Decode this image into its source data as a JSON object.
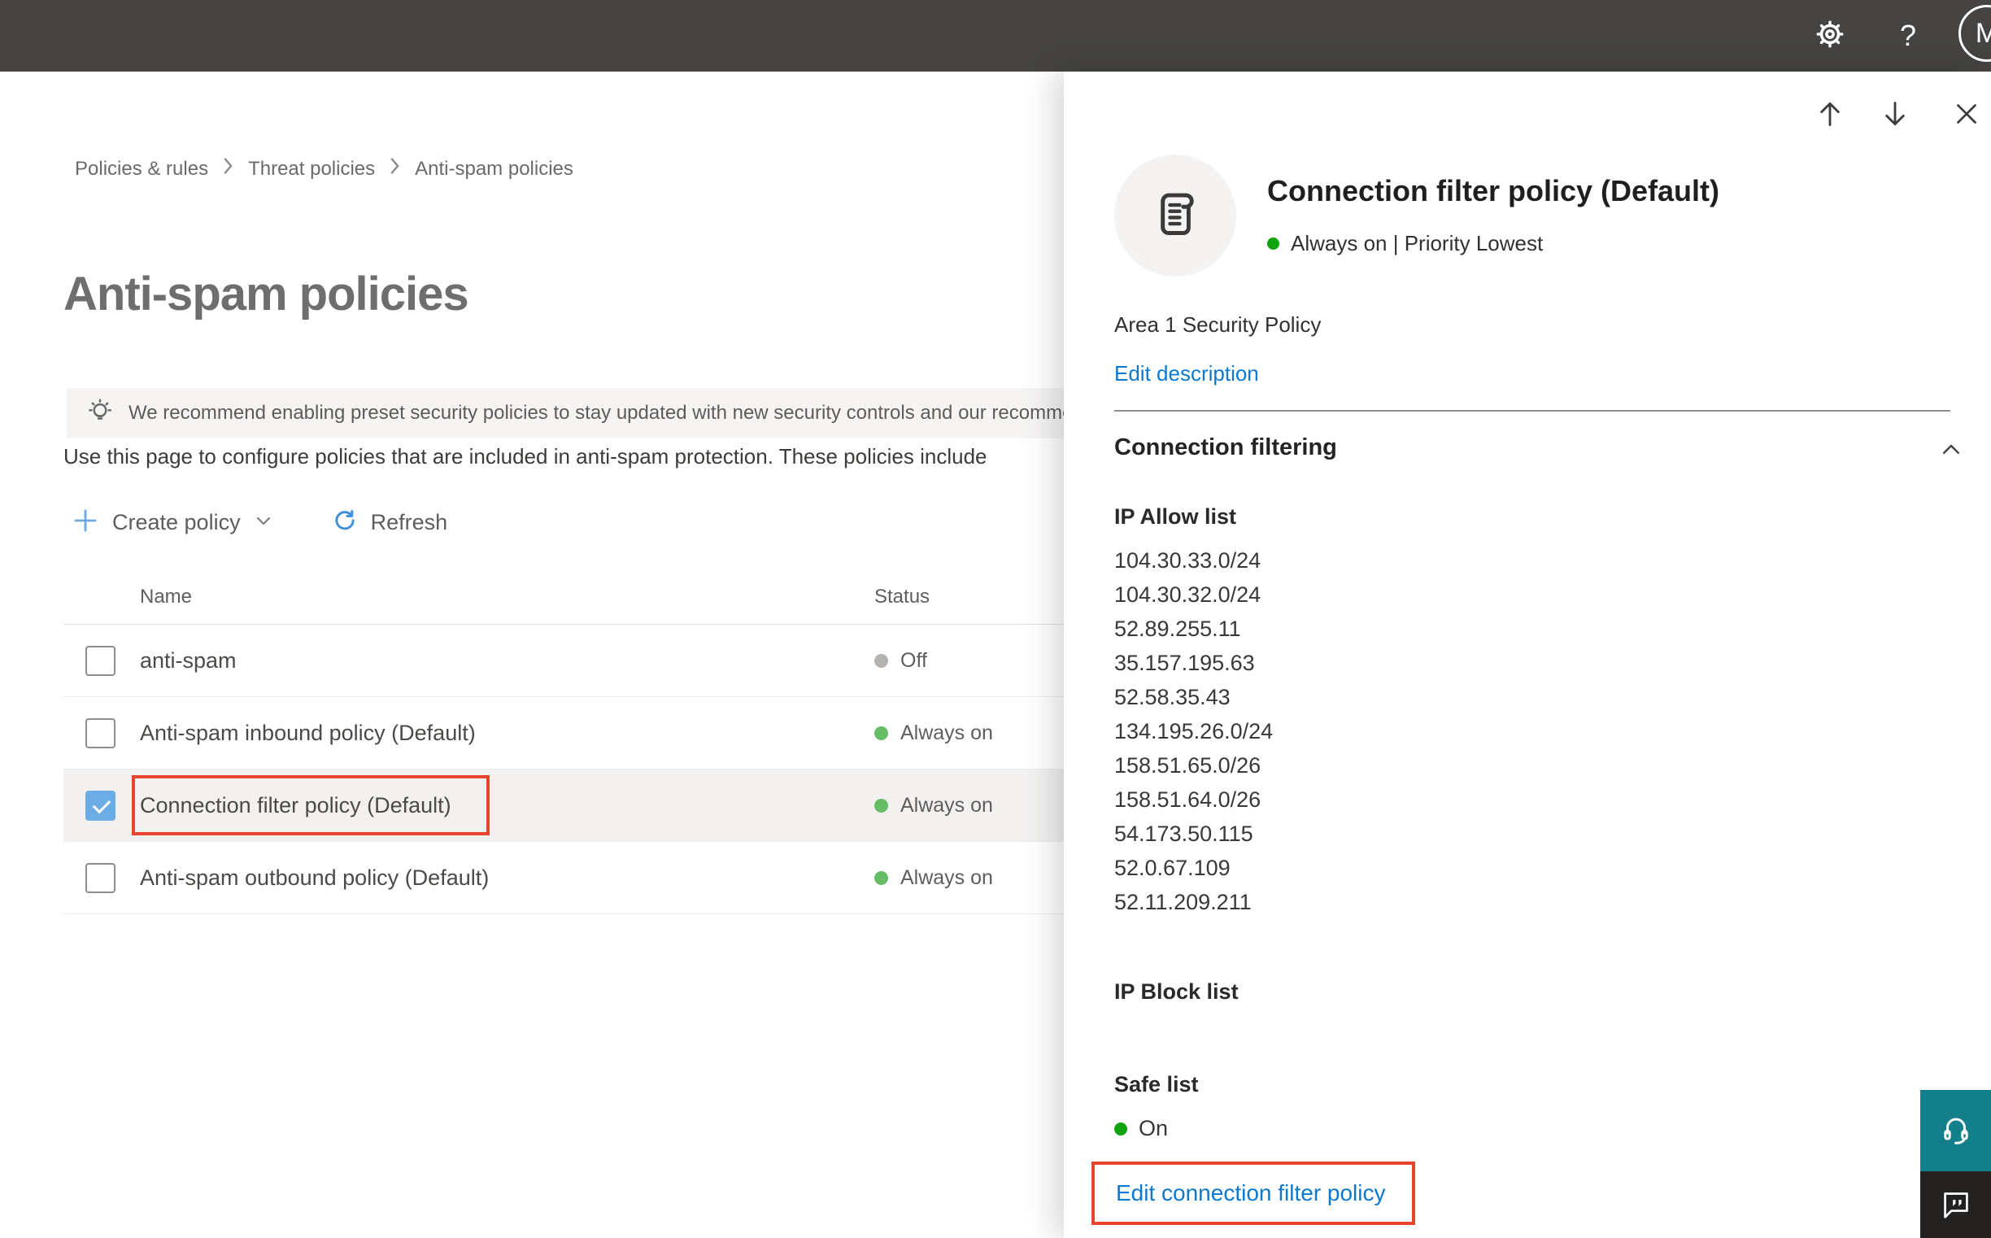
{
  "topbar": {
    "help_label": "?",
    "avatar_initial": "M"
  },
  "breadcrumb": {
    "items": [
      "Policies & rules",
      "Threat policies",
      "Anti-spam policies"
    ]
  },
  "page": {
    "title": "Anti-spam policies",
    "banner_text": "We recommend enabling preset security policies to stay updated with new security controls and our recomme",
    "intro_text": "Use this page to configure policies that are included in anti-spam protection. These policies include",
    "create_policy_label": "Create policy",
    "refresh_label": "Refresh"
  },
  "table": {
    "columns": [
      "Name",
      "Status"
    ],
    "rows": [
      {
        "name": "anti-spam",
        "status": "Off",
        "checked": false,
        "selected": false,
        "highlighted": false
      },
      {
        "name": "Anti-spam inbound policy (Default)",
        "status": "Always on",
        "checked": false,
        "selected": false,
        "highlighted": false
      },
      {
        "name": "Connection filter policy (Default)",
        "status": "Always on",
        "checked": true,
        "selected": true,
        "highlighted": true
      },
      {
        "name": "Anti-spam outbound policy (Default)",
        "status": "Always on",
        "checked": false,
        "selected": false,
        "highlighted": false
      }
    ]
  },
  "flyout": {
    "title": "Connection filter policy (Default)",
    "status_text": "Always on | Priority Lowest",
    "description": "Area 1 Security Policy",
    "edit_description_label": "Edit description",
    "section_title": "Connection filtering",
    "ip_allow_title": "IP Allow list",
    "ip_allow_list": [
      "104.30.33.0/24",
      "104.30.32.0/24",
      "52.89.255.11",
      "35.157.195.63",
      "52.58.35.43",
      "134.195.26.0/24",
      "158.51.65.0/26",
      "158.51.64.0/26",
      "54.173.50.115",
      "52.0.67.109",
      "52.11.209.211"
    ],
    "ip_block_title": "IP Block list",
    "safe_list_title": "Safe list",
    "safe_list_status": "On",
    "edit_policy_label": "Edit connection filter policy"
  },
  "colors": {
    "topbar_bg": "#454442",
    "accent": "#0b79d0",
    "red_highlight": "#e7452e",
    "status_green": "#66bd66",
    "status_green_bright": "#0fa30f",
    "status_gray": "#b5b2b0",
    "check_blue": "#6cace4",
    "teal_button": "#137f8b",
    "chat_button": "#232221",
    "selected_row_bg": "#f2f1f0"
  }
}
